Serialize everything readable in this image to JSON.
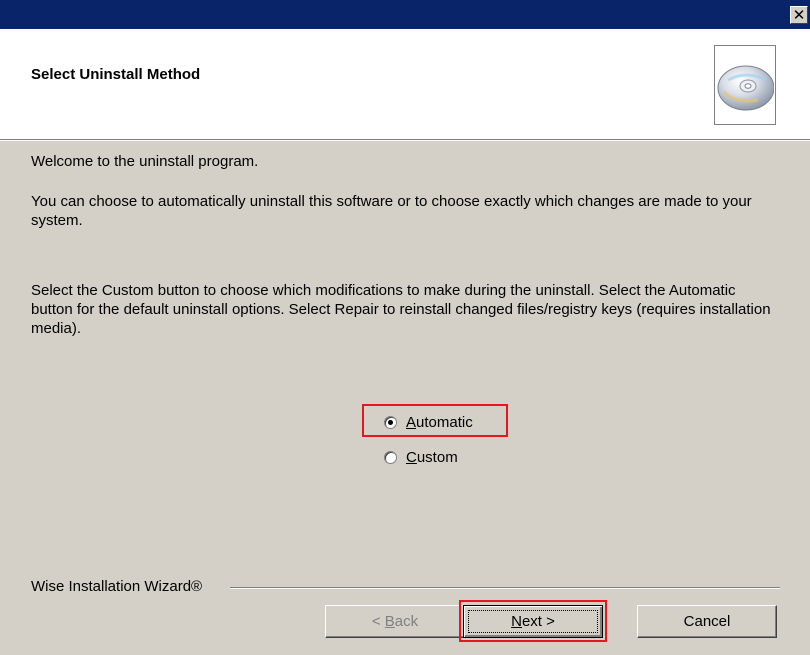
{
  "window": {
    "close_glyph": "✕",
    "header_title": "Select Uninstall Method",
    "header_icon": "cd-disc-icon"
  },
  "body": {
    "welcome": "Welcome to the  uninstall program.",
    "choose": "You can choose to automatically uninstall this software or to choose exactly which changes are made to your system.",
    "instructions": "Select the Custom button to choose which modifications to make during the uninstall. Select the Automatic button for the default uninstall options. Select Repair to reinstall changed files/registry keys (requires installation media)."
  },
  "options": {
    "automatic": {
      "mnemonic": "A",
      "rest": "utomatic",
      "checked": true
    },
    "custom": {
      "mnemonic": "C",
      "rest": "ustom",
      "checked": false
    }
  },
  "footer": {
    "label": "Wise Installation Wizard®",
    "back": {
      "prefix": "< ",
      "mnemonic": "B",
      "rest": "ack"
    },
    "next": {
      "mnemonic": "N",
      "rest": "ext >"
    },
    "cancel": "Cancel"
  },
  "colors": {
    "titlebar": "#0a246a",
    "dialog_bg": "#d4d0c8",
    "highlight": "#e8141e"
  }
}
